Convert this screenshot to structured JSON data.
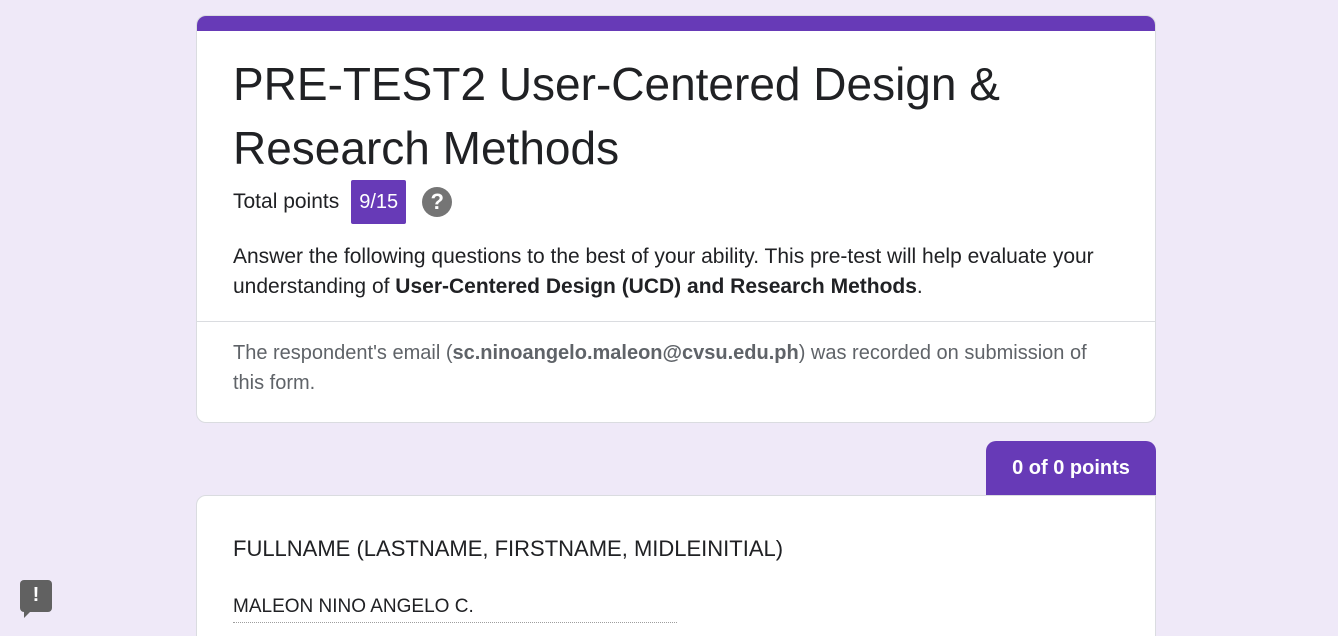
{
  "form": {
    "title": "PRE-TEST2 User-Centered Design & Research Methods",
    "total_points_label": "Total points",
    "score": "9/15",
    "help_icon": "?",
    "description": {
      "prefix": " Answer the following questions to the best of your ability. This pre-test will help evaluate your understanding of ",
      "emphasis": "User-Centered Design (UCD) and Research Methods",
      "suffix": "."
    },
    "email_note": {
      "prefix": "The respondent's email (",
      "email": "sc.ninoangelo.maleon@cvsu.edu.ph",
      "suffix": ") was recorded on submission of this form."
    }
  },
  "section": {
    "points": "0 of 0 points"
  },
  "question": {
    "title": "FULLNAME (LASTNAME, FIRSTNAME, MIDLEINITIAL)",
    "answer": "MALEON NINO ANGELO C."
  },
  "feedback": {
    "icon": "!"
  },
  "colors": {
    "accent": "#673ab7",
    "background": "#efe9f8"
  }
}
